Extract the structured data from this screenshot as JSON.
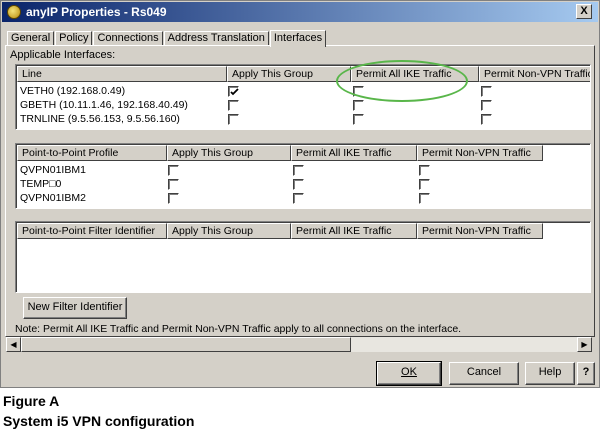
{
  "window": {
    "title": "anyIP Properties - Rs049",
    "close_glyph": "X"
  },
  "tabs": [
    {
      "label": "General"
    },
    {
      "label": "Policy"
    },
    {
      "label": "Connections"
    },
    {
      "label": "Address Translation"
    },
    {
      "label": "Interfaces",
      "active": true
    }
  ],
  "applicable_label": "Applicable Interfaces:",
  "table1": {
    "columns": [
      "Line",
      "Apply This Group",
      "Permit All IKE Traffic",
      "Permit Non-VPN Traffic"
    ],
    "rows": [
      {
        "name": "VETH0 (192.168.0.49)",
        "apply": true,
        "ike": false,
        "nonvpn": false
      },
      {
        "name": "GBETH (10.11.1.46, 192.168.40.49)",
        "apply": false,
        "ike": false,
        "nonvpn": false
      },
      {
        "name": "TRNLINE (9.5.56.153, 9.5.56.160)",
        "apply": false,
        "ike": false,
        "nonvpn": false
      }
    ]
  },
  "table2": {
    "columns": [
      "Point-to-Point Profile",
      "Apply This Group",
      "Permit All IKE Traffic",
      "Permit Non-VPN Traffic"
    ],
    "rows": [
      {
        "name": "QVPN01IBM1",
        "apply": false,
        "ike": false,
        "nonvpn": false
      },
      {
        "name": "TEMP□0",
        "apply": false,
        "ike": false,
        "nonvpn": false
      },
      {
        "name": "QVPN01IBM2",
        "apply": false,
        "ike": false,
        "nonvpn": false
      }
    ]
  },
  "table3": {
    "columns": [
      "Point-to-Point Filter Identifier",
      "Apply This Group",
      "Permit All IKE Traffic",
      "Permit Non-VPN Traffic"
    ],
    "rows": []
  },
  "buttons": {
    "new_filter": "New Filter Identifier",
    "ok": "OK",
    "cancel": "Cancel",
    "help": "Help",
    "whatsthis": "?"
  },
  "note": "Note:  Permit All IKE Traffic and Permit Non-VPN Traffic apply to all connections on the interface.",
  "caption": {
    "figure": "Figure A",
    "text": "System i5 VPN configuration"
  },
  "colors": {
    "title_bar": "#0a246a",
    "dialog_bg": "#d4d0c8",
    "highlight_ellipse": "#59b64a"
  },
  "icons": {
    "title": "app-globe-icon",
    "close": "close-icon",
    "check": "check-icon",
    "scroll_left": "arrow-left-icon",
    "scroll_right": "arrow-right-icon"
  }
}
